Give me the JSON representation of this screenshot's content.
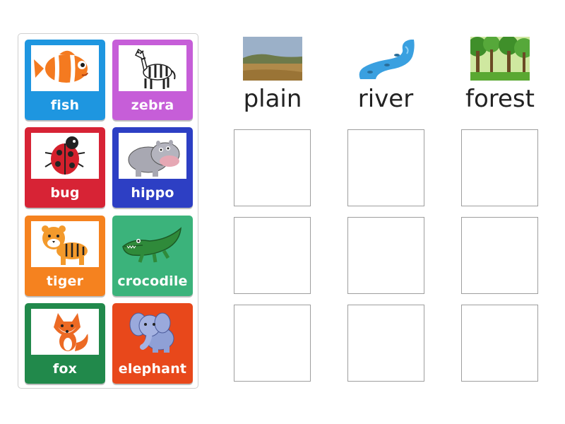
{
  "cards": [
    {
      "label": "fish",
      "color": "#1e96e0",
      "icon": "fish-icon"
    },
    {
      "label": "zebra",
      "color": "#c65ed8",
      "icon": "zebra-icon"
    },
    {
      "label": "bug",
      "color": "#d72335",
      "icon": "ladybug-icon"
    },
    {
      "label": "hippo",
      "color": "#2d3fc4",
      "icon": "hippo-icon"
    },
    {
      "label": "tiger",
      "color": "#f5821f",
      "icon": "tiger-icon"
    },
    {
      "label": "crocodile",
      "color": "#3bb37b",
      "icon": "crocodile-icon"
    },
    {
      "label": "fox",
      "color": "#21894b",
      "icon": "fox-icon"
    },
    {
      "label": "elephant",
      "color": "#e8481b",
      "icon": "elephant-icon"
    }
  ],
  "categories": [
    {
      "label": "plain",
      "icon": "plain-landscape-icon"
    },
    {
      "label": "river",
      "icon": "river-icon"
    },
    {
      "label": "forest",
      "icon": "forest-icon"
    }
  ]
}
